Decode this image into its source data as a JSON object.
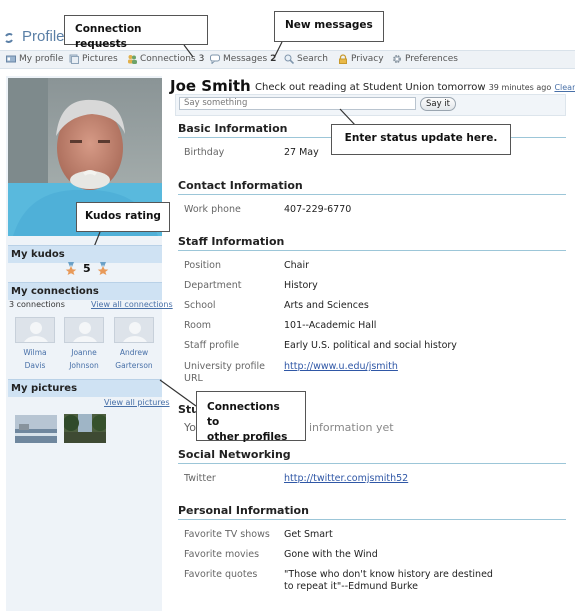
{
  "header": {
    "title": "Profile"
  },
  "nav": {
    "my_profile": "My profile",
    "pictures": "Pictures",
    "connections": "Connections",
    "connections_count": "3",
    "messages": "Messages",
    "messages_count": "2",
    "search": "Search",
    "privacy": "Privacy",
    "preferences": "Preferences"
  },
  "callouts": {
    "connection_requests": "Connection requests",
    "new_messages": "New messages",
    "status_update": "Enter status update here.",
    "kudos_rating": "Kudos rating",
    "connections_line1": "Connections to",
    "connections_line2": "other profiles"
  },
  "left": {
    "kudos_title": "My kudos",
    "kudos_value": "5",
    "connections_title": "My connections",
    "connections_count": "3 connections",
    "view_all_connections": "View all connections",
    "connections": [
      {
        "first": "Wilma",
        "last": "Davis"
      },
      {
        "first": "Joanne",
        "last": "Johnson"
      },
      {
        "first": "Andrew",
        "last": "Garterson"
      }
    ],
    "pictures_title": "My pictures",
    "view_all_pictures": "View all pictures"
  },
  "profile": {
    "name": "Joe Smith",
    "status": "Check out reading at Student Union tomorrow",
    "status_time": "39 minutes ago",
    "clear": "Clear",
    "say_placeholder": "Say something",
    "say_button": "Say it"
  },
  "basic": {
    "title": "Basic Information",
    "birthday_label": "Birthday",
    "birthday": "27 May"
  },
  "contact": {
    "title": "Contact Information",
    "work_phone_label": "Work phone",
    "work_phone": "407-229-6770"
  },
  "staff": {
    "title": "Staff Information",
    "position_label": "Position",
    "position": "Chair",
    "department_label": "Department",
    "department": "History",
    "school_label": "School",
    "school": "Arts and Sciences",
    "room_label": "Room",
    "room": "101--Academic Hall",
    "staff_profile_label": "Staff profile",
    "staff_profile": "Early U.S. political and social history",
    "url_label_1": "University profile",
    "url_label_2": "URL",
    "url": "http://www.u.edu/jsmith"
  },
  "student": {
    "title_partial": "Stu",
    "text_partial_left": "You",
    "text_partial_right": "information yet"
  },
  "social": {
    "title": "Social Networking",
    "twitter_label": "Twitter",
    "twitter": "http://twitter.comjsmith52"
  },
  "personal": {
    "title": "Personal Information",
    "tv_label": "Favorite TV shows",
    "tv": "Get Smart",
    "movies_label": "Favorite movies",
    "movies": "Gone with the Wind",
    "quotes_label": "Favorite quotes",
    "quote_line1": "\"Those who don't know history are destined",
    "quote_line2": "to repeat it\"--Edmund Burke"
  },
  "colors": {
    "accent": "#4870a8",
    "section_head": "#cfe2f3",
    "rule": "#9cc6d8"
  }
}
